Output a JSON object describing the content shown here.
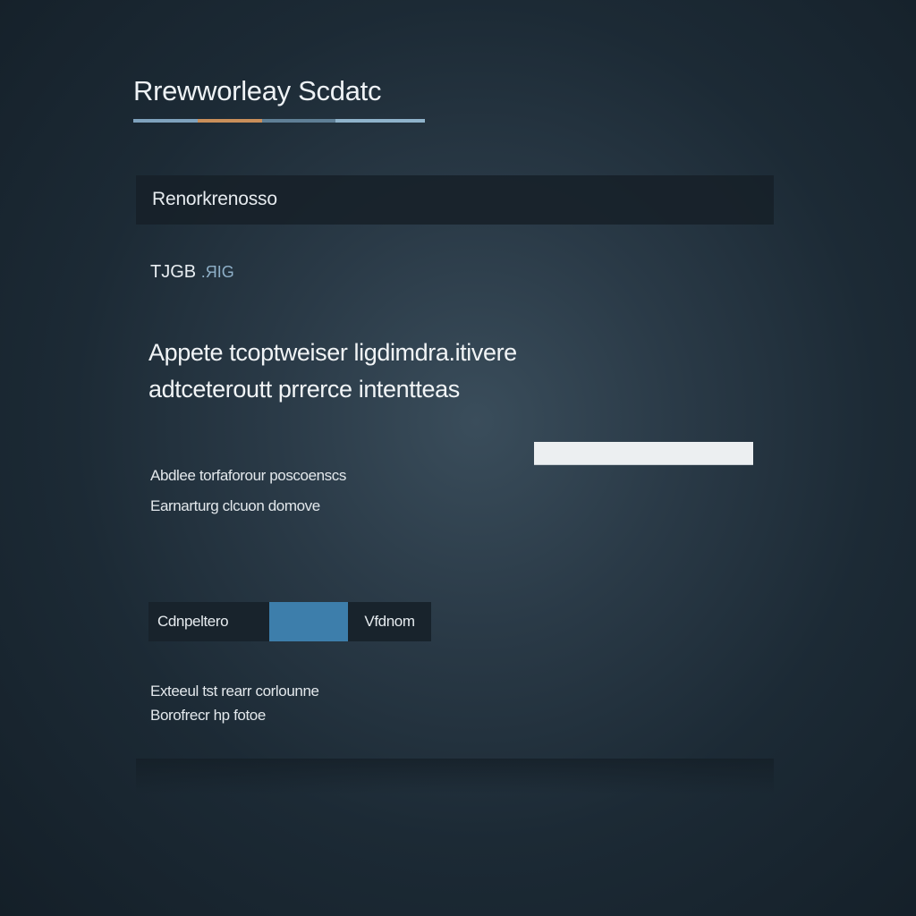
{
  "page": {
    "title": "Rrewworleay Scdatc",
    "accent_colors": [
      "#7fa2bd",
      "#c98f5a",
      "#5f7f96",
      "#8fb3cb"
    ]
  },
  "header_bar": {
    "label": "Renorkrenosso"
  },
  "tag": {
    "strong": "TJGB",
    "dim": ".ЯIG"
  },
  "heading": {
    "line1": "Appete tcoptweiser ligdimdra.itivere",
    "line2": "adtceteroutt prrerce intentteas"
  },
  "text_input": {
    "value": "",
    "placeholder": ""
  },
  "description": {
    "line1": "Abdlee torfaforour poscoenscs",
    "line2": "Earnarturg clcuon domove"
  },
  "segmented_control": {
    "left_label": "Cdnpeltero",
    "middle_label": "",
    "right_label": "Vfdnom",
    "selected_color": "#3d7eab"
  },
  "footer_note": {
    "line1": "Exteeul tst rearr corlounne",
    "line2": "Borofrecr hp fotoe"
  }
}
